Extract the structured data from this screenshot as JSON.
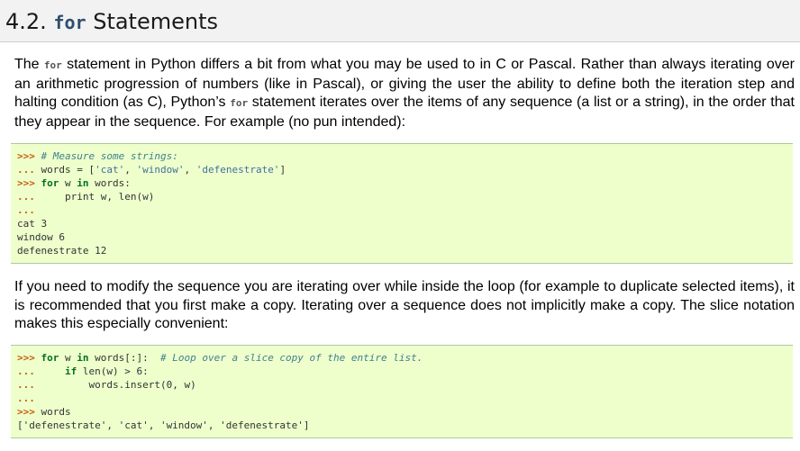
{
  "section": {
    "number": "4.2.",
    "keyword": "for",
    "title": "Statements"
  },
  "paragraph1": {
    "part1": "The ",
    "code1": "for",
    "part2": " statement in Python differs a bit from what you may be used to in C or Pascal. Rather than always iterating over an arithmetic progression of numbers (like in Pascal), or giving the user the ability to define both the iteration step and halting condition (as C), Python’s ",
    "code2": "for",
    "part3": " statement iterates over the items of any sequence (a list or a string), in the order that they appear in the sequence. For example (no pun intended):"
  },
  "paragraph2": {
    "text": "If you need to modify the sequence you are iterating over while inside the loop (for example to duplicate selected items), it is recommended that you first make a copy. Iterating over a sequence does not implicitly make a copy. The slice notation makes this especially convenient:"
  },
  "code1": {
    "l1_prompt": ">>>",
    "l1_comment": "# Measure some strings:",
    "l2_prompt": "...",
    "l2_a": "words = [",
    "l2_s1": "'cat'",
    "l2_c1": ", ",
    "l2_s2": "'window'",
    "l2_c2": ", ",
    "l2_s3": "'defenestrate'",
    "l2_end": "]",
    "l3_prompt": ">>>",
    "l3_k1": "for",
    "l3_a": " w ",
    "l3_k2": "in",
    "l3_b": " words:",
    "l4_prompt": "...",
    "l4_text": "    print w, len(w)",
    "l5_prompt": "...",
    "out1": "cat 3",
    "out2": "window 6",
    "out3": "defenestrate 12"
  },
  "code2": {
    "l1_prompt": ">>>",
    "l1_k1": "for",
    "l1_a": " w ",
    "l1_k2": "in",
    "l1_b": " words[:]:  ",
    "l1_comment": "# Loop over a slice copy of the entire list.",
    "l2_prompt": "...",
    "l2_k": "if",
    "l2_text": " len(w) > 6:",
    "l3_prompt": "...",
    "l3_text": "        words.insert(0, w)",
    "l4_prompt": "...",
    "l5_prompt": ">>>",
    "l5_text": " words",
    "out1": "['defenestrate', 'cat', 'window', 'defenestrate']"
  }
}
